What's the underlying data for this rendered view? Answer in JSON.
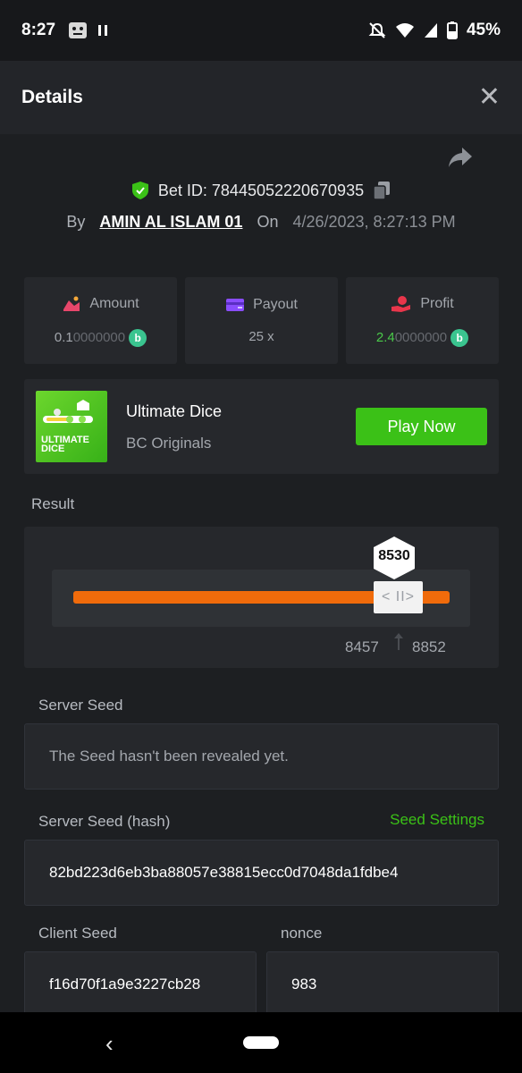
{
  "status_bar": {
    "time": "8:27",
    "battery": "45%"
  },
  "header": {
    "title": "Details",
    "close_icon": "close-icon"
  },
  "bet": {
    "id_label": "Bet ID: 78445052220670935",
    "by_label": "By",
    "user": "AMIN AL ISLAM 01",
    "on_label": "On",
    "date": "4/26/2023, 8:27:13 PM"
  },
  "stats": {
    "amount": {
      "label": "Amount",
      "value_bright": "0.1",
      "value_dim": "0000000"
    },
    "payout": {
      "label": "Payout",
      "value": "25 x"
    },
    "profit": {
      "label": "Profit",
      "value_bright": "2.4",
      "value_dim": "0000000"
    }
  },
  "game": {
    "thumb_text_1": "ULTIMATE",
    "thumb_text_2": "DICE",
    "name": "Ultimate Dice",
    "provider": "BC Originals",
    "play_label": "Play Now"
  },
  "result": {
    "label": "Result",
    "value": "8530",
    "range_low": "8457",
    "range_high": "8852",
    "handle_glyph": "< II>"
  },
  "seeds": {
    "server_seed_label": "Server Seed",
    "server_seed_value": "The Seed hasn't been revealed yet.",
    "server_hash_label": "Server Seed (hash)",
    "seed_settings_label": "Seed Settings",
    "server_hash_value": "82bd223d6eb3ba88057e38815ecc0d7048da1fdbe4",
    "client_seed_label": "Client Seed",
    "client_seed_value": "f16d70f1a9e3227cb28",
    "nonce_label": "nonce",
    "nonce_value": "983"
  },
  "colors": {
    "accent_green": "#3bc117",
    "profit_green": "#4ac94a",
    "track_orange": "#f06b0b",
    "coin_teal": "#3ac48f"
  },
  "nav": {
    "back_glyph": "‹"
  }
}
